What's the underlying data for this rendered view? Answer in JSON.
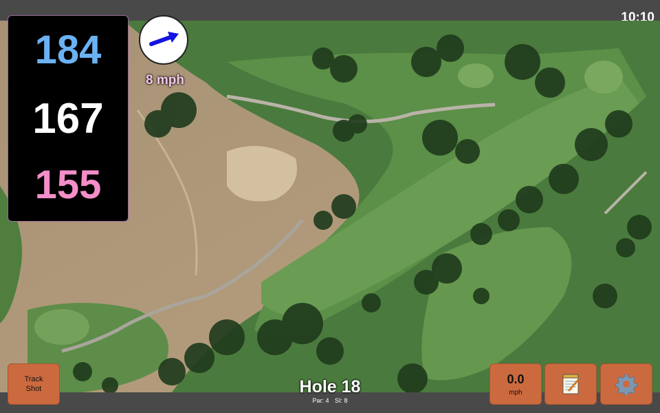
{
  "status": {
    "time": "10:10"
  },
  "distances": {
    "back": "184",
    "center": "167",
    "front": "155"
  },
  "wind": {
    "speed": "8 mph",
    "direction_icon": "wind-arrow-icon"
  },
  "hole": {
    "title": "Hole 18",
    "par": "Par: 4",
    "si": "SI: 8"
  },
  "buttons": {
    "track_shot": {
      "line1": "Track",
      "line2": "Shot"
    },
    "speed": {
      "value": "0.0",
      "unit": "mph"
    },
    "notes_icon": "notepad-icon",
    "settings_icon": "gear-icon"
  },
  "colors": {
    "back_distance": "#6ab2f2",
    "center_distance": "#ffffff",
    "front_distance": "#f48ec8",
    "button": "#cc6a3f",
    "bar": "#494949"
  }
}
